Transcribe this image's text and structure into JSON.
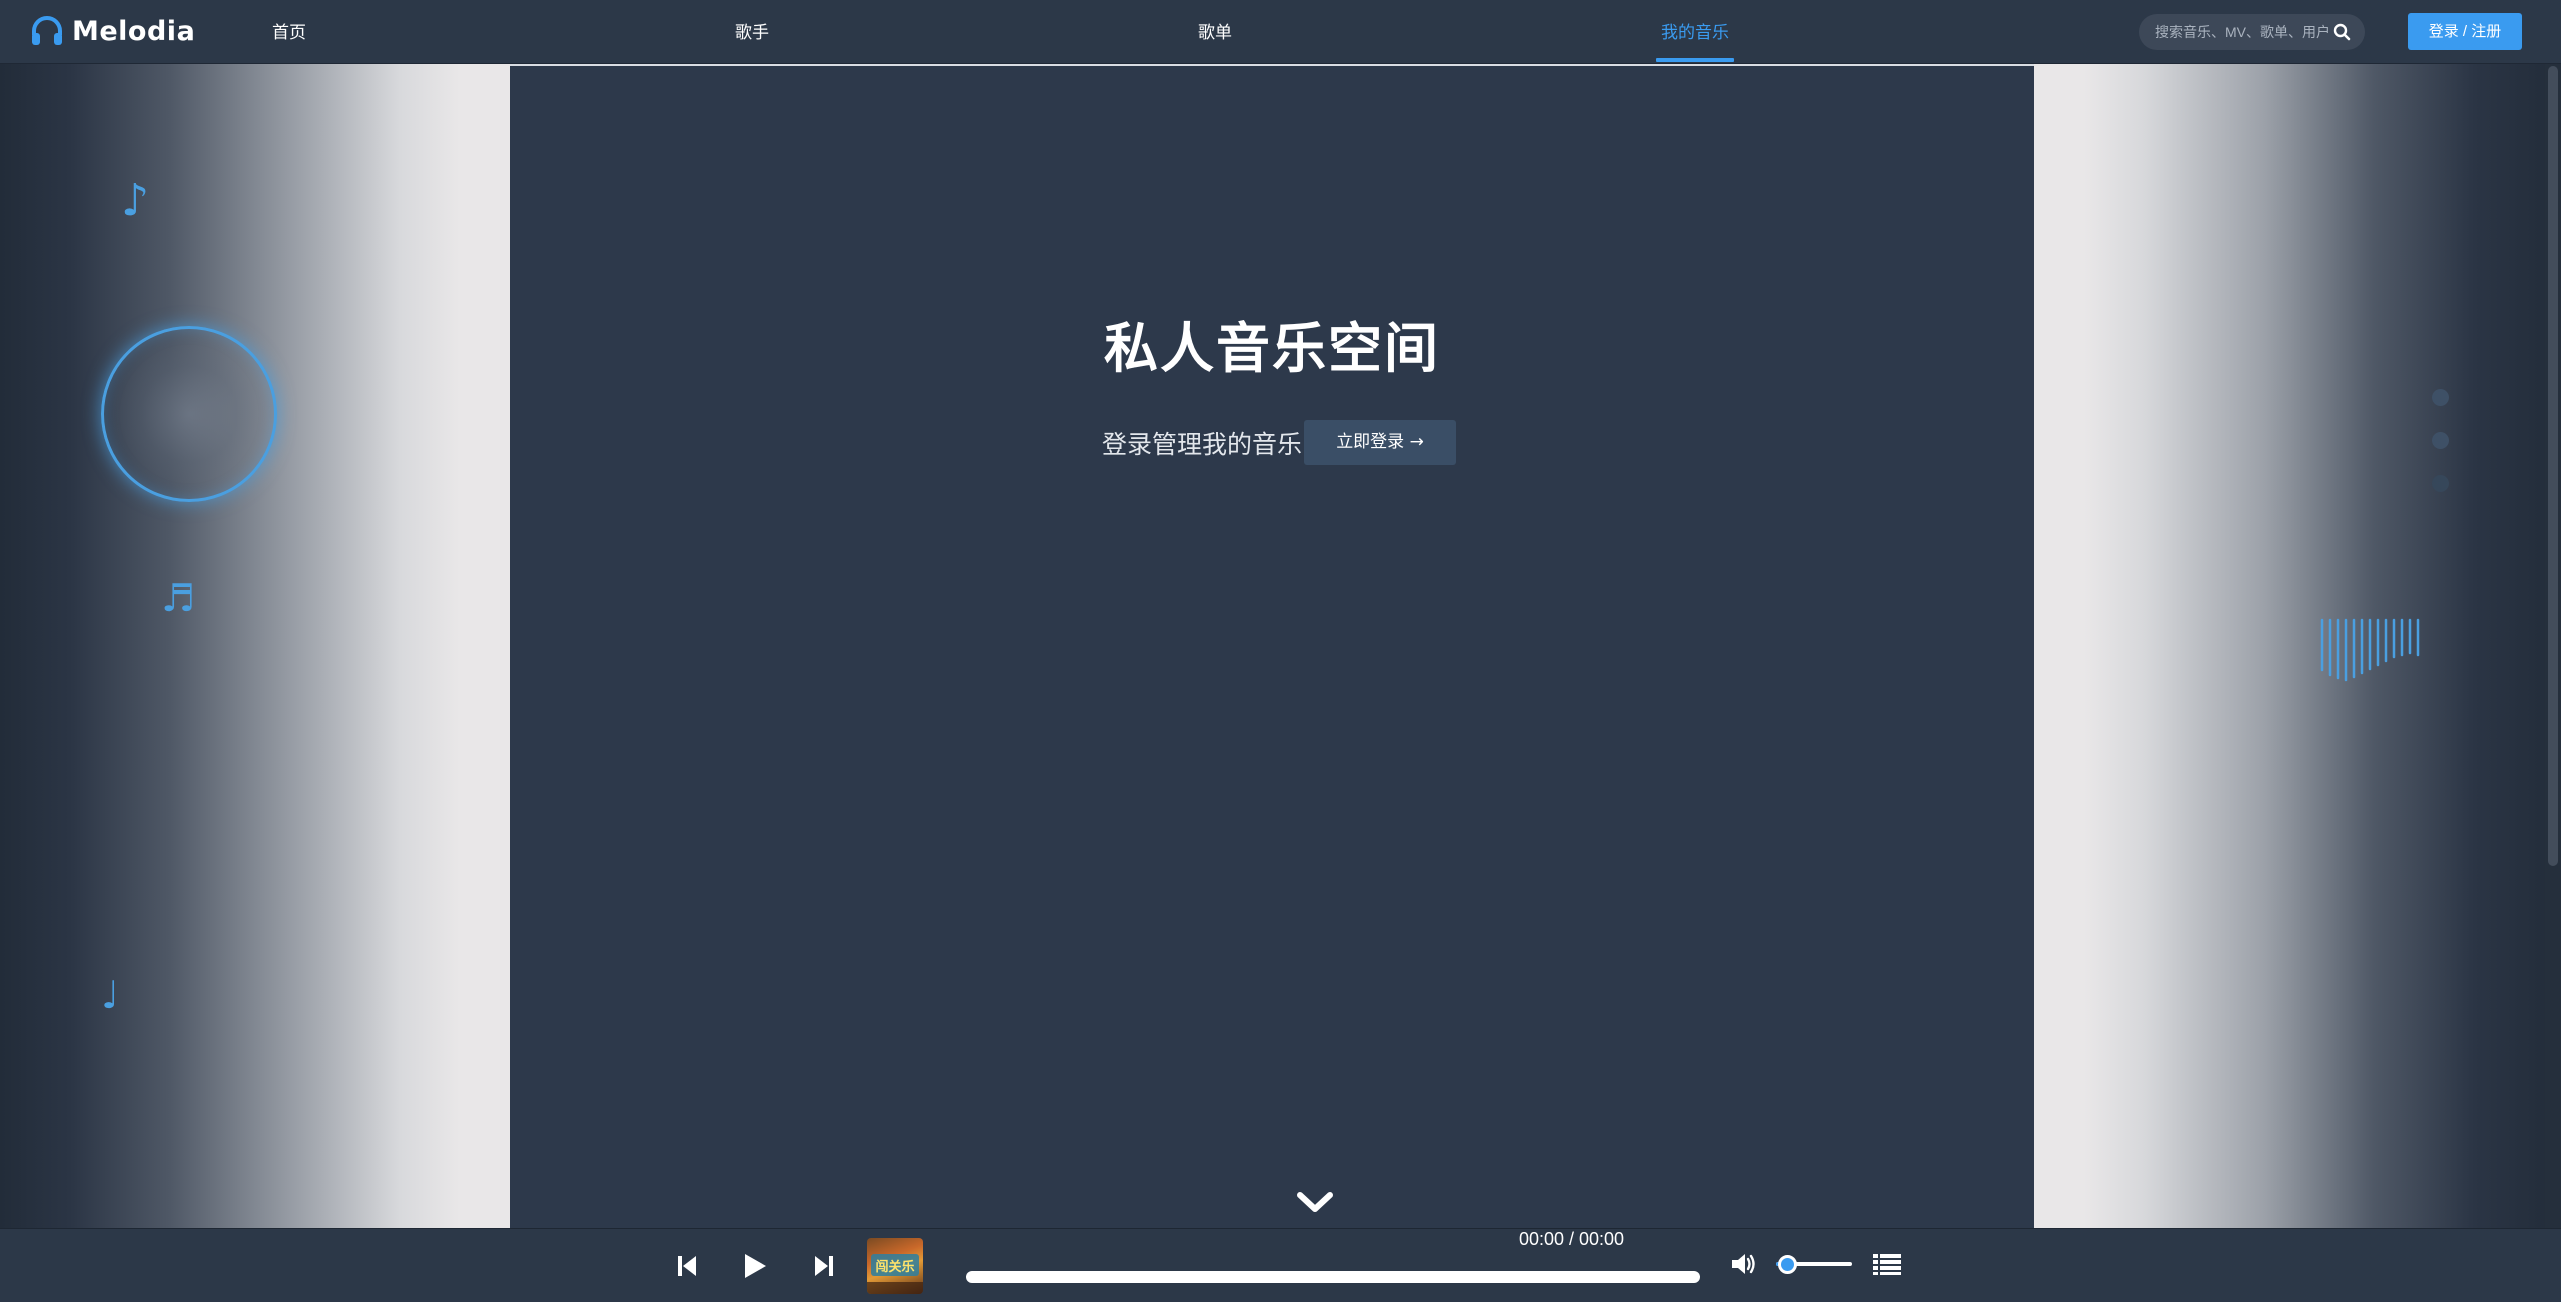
{
  "brand": {
    "name": "Melodia",
    "accent": "#3a9bf0",
    "icon": "headphones-icon"
  },
  "nav": {
    "items": [
      {
        "label": "首页",
        "active": false
      },
      {
        "label": "歌手",
        "active": false
      },
      {
        "label": "歌单",
        "active": false
      },
      {
        "label": "我的音乐",
        "active": true
      }
    ]
  },
  "search": {
    "placeholder": "搜索音乐、MV、歌单、用户",
    "icon": "search-icon"
  },
  "auth": {
    "login_label": "登录 / 注册"
  },
  "hero": {
    "title": "私人音乐空间",
    "subtitle": "登录管理我的音乐",
    "cta_label": "立即登录 →"
  },
  "decor": {
    "notes": [
      "♪",
      "♬",
      "♩"
    ],
    "dot_colors": [
      "#3e5066",
      "#3e5066",
      "#36475a"
    ]
  },
  "player": {
    "time_display": "00:00 / 00:00",
    "progress": 0,
    "volume": 0.15,
    "icons": [
      "skip-back-icon",
      "play-icon",
      "skip-forward-icon",
      "volume-icon",
      "playlist-icon"
    ],
    "album_art_text": "闯关乐"
  }
}
